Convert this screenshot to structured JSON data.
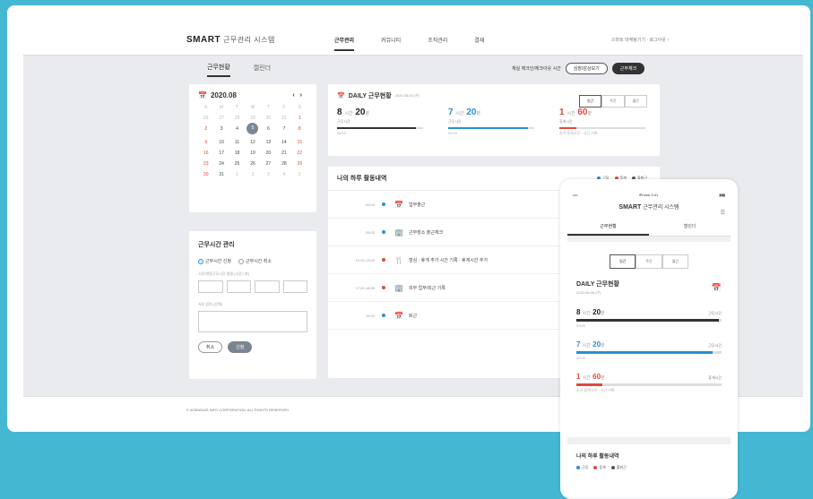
{
  "app": {
    "logo_bold": "SMART",
    "logo_rest": "근무관리 시스템"
  },
  "nav": [
    "근무관리",
    "커뮤니티",
    "조직관리",
    "결재"
  ],
  "user_info": "스마트 마케팅기기 · 로그아웃 ›",
  "subtabs": [
    "근무현황",
    "캘린더"
  ],
  "controls": {
    "label": "재실 체크인/체크아웃 시간",
    "btn1": "심장/감상보기",
    "btn2": "근무체크"
  },
  "calendar": {
    "title": "2020.08",
    "weekdays": [
      "S",
      "M",
      "T",
      "W",
      "T",
      "F",
      "S"
    ],
    "days": [
      "26",
      "27",
      "28",
      "29",
      "30",
      "31",
      "1",
      "2",
      "3",
      "4",
      "5",
      "6",
      "7",
      "8",
      "9",
      "10",
      "11",
      "12",
      "13",
      "14",
      "15",
      "16",
      "17",
      "18",
      "19",
      "20",
      "21",
      "22",
      "23",
      "24",
      "25",
      "26",
      "27",
      "28",
      "29",
      "30",
      "31",
      "1",
      "2",
      "3",
      "4",
      "5"
    ],
    "selected": "5"
  },
  "mgmt": {
    "title": "근무시간 관리",
    "radio1": "근무시간 신청",
    "radio2": "근무시간 취소",
    "label1": "시간/연장근무시간 설정 (시간 / 분)",
    "label2": "사유 입력 (선택)",
    "cancel": "취소",
    "submit": "신청"
  },
  "daily": {
    "title": "DAILY 근무현황",
    "date": "2020.08.05 (수)",
    "seg": [
      "일간",
      "주간",
      "월간"
    ],
    "stats": [
      {
        "h": "8",
        "m": "20",
        "label": "근무시간",
        "note": "09:00",
        "color": "#333333",
        "ratio": 0.92
      },
      {
        "h": "7",
        "m": "20",
        "label": "근무시간",
        "note": "09:00",
        "color": "#2a8fd6",
        "ratio": 0.93
      },
      {
        "h": "1",
        "m": "60",
        "label": "휴게시간",
        "note": "추가 휴게시간 · 시간 기록",
        "color": "#e04a3b",
        "ratio": 0.2
      }
    ],
    "hour_unit": "시간",
    "min_unit": "분"
  },
  "activity": {
    "title": "나의 하루 활동내역",
    "legend": [
      {
        "label": "근무",
        "color": "#2a8fd6"
      },
      {
        "label": "휴게",
        "color": "#e04a3b"
      },
      {
        "label": "출퇴근",
        "color": "#555555"
      }
    ],
    "rows": [
      {
        "time": "09:00",
        "color": "#2a8fd6",
        "icon": "📅",
        "text": "업무출근"
      },
      {
        "time": "09:00",
        "color": "#2a8fd6",
        "icon": "🏢",
        "text": "근무장소 출근체크"
      },
      {
        "time": "12:00-13:00",
        "color": "#e04a3b",
        "icon": "🍴",
        "text": "점심 · 휴게 추가 시간 기록 · 휴게시간 추가"
      },
      {
        "time": "17:00-18:00",
        "color": "#e04a3b",
        "icon": "🏢",
        "text": "외부 업무/외근 기록"
      },
      {
        "time": "18:00",
        "color": "#2a8fd6",
        "icon": "📅",
        "text": "퇴근"
      }
    ]
  },
  "footer": "© AGENDAIS INFO CORPORATION. ALL RIGHTS RESERVED.",
  "phone": {
    "carrier": "•••• ",
    "time": "iPhone 9:41",
    "battery": "▮▮▮",
    "header_bold": "SMART",
    "header_rest": "근무관리 시스템",
    "tabs": [
      "근무현황",
      "캘린더"
    ],
    "seg": [
      "일간",
      "주간",
      "월간"
    ],
    "title": "DAILY 근무현황",
    "date": "2020.08.05 (수)",
    "stats": [
      {
        "h": "8",
        "m": "20",
        "label": "근무시간",
        "note": "09:00",
        "color": "#333333",
        "ratio": 0.98
      },
      {
        "h": "7",
        "m": "20",
        "label": "근무시간",
        "note": "09:00",
        "color": "#2a8fd6",
        "ratio": 0.94
      },
      {
        "h": "1",
        "m": "60",
        "label": "휴게시간",
        "note": "추가 휴게시간 · 시간 기록",
        "color": "#e04a3b",
        "ratio": 0.18
      }
    ],
    "act_title": "나의 하루 활동내역"
  }
}
